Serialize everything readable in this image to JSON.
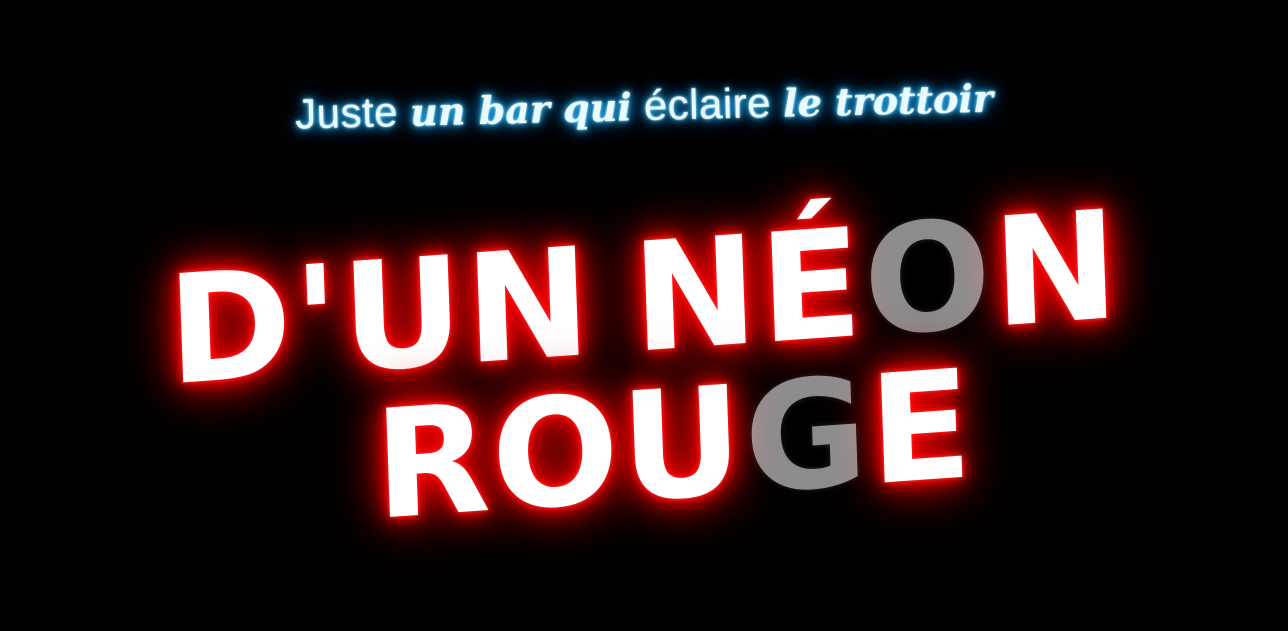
{
  "subtitle": {
    "part1": "Juste ",
    "part2": "un bar qui",
    "part3": " éclaire ",
    "part4": "le trottoir"
  },
  "headline": {
    "line1": {
      "a": "D'UN",
      "b": "NÉ",
      "c": "O",
      "d": "N"
    },
    "line2": {
      "a": "ROU",
      "b": "G",
      "c": "E"
    }
  },
  "colors": {
    "background": "#000000",
    "subtitle_glow": "#1fa8ff",
    "headline_glow": "#ff0000",
    "headline_text": "#ffffff"
  }
}
